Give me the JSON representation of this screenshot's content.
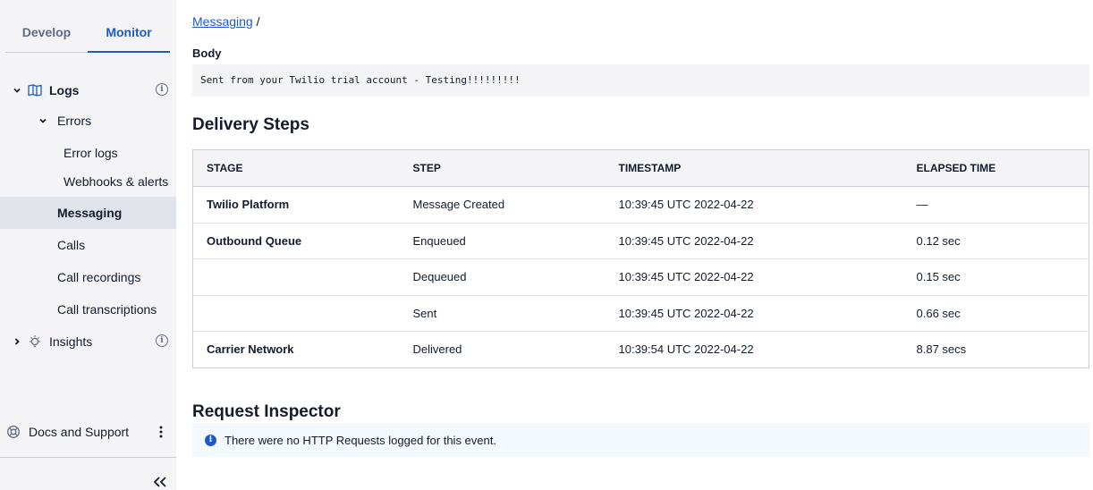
{
  "sidebar": {
    "tabs": [
      {
        "label": "Develop",
        "active": false
      },
      {
        "label": "Monitor",
        "active": true
      }
    ],
    "logs_label": "Logs",
    "errors_label": "Errors",
    "error_logs_label": "Error logs",
    "webhooks_label": "Webhooks & alerts",
    "messaging_label": "Messaging",
    "calls_label": "Calls",
    "call_recordings_label": "Call recordings",
    "call_transcriptions_label": "Call transcriptions",
    "insights_label": "Insights",
    "docs_label": "Docs and Support"
  },
  "main": {
    "breadcrumb": {
      "link": "Messaging",
      "separator": "/"
    },
    "body_label": "Body",
    "body_text": "Sent from your Twilio trial account - Testing!!!!!!!!!",
    "delivery_title": "Delivery Steps",
    "table": {
      "headers": [
        "STAGE",
        "STEP",
        "TIMESTAMP",
        "ELAPSED TIME"
      ],
      "rows": [
        {
          "stage": "Twilio Platform",
          "step": "Message Created",
          "timestamp": "10:39:45 UTC 2022-04-22",
          "elapsed": "—"
        },
        {
          "stage": "Outbound Queue",
          "step": "Enqueued",
          "timestamp": "10:39:45 UTC 2022-04-22",
          "elapsed": "0.12 sec"
        },
        {
          "stage": "",
          "step": "Dequeued",
          "timestamp": "10:39:45 UTC 2022-04-22",
          "elapsed": "0.15 sec"
        },
        {
          "stage": "",
          "step": "Sent",
          "timestamp": "10:39:45 UTC 2022-04-22",
          "elapsed": "0.66 sec"
        },
        {
          "stage": "Carrier Network",
          "step": "Delivered",
          "timestamp": "10:39:54 UTC 2022-04-22",
          "elapsed": "8.87 secs"
        }
      ]
    },
    "inspector_title": "Request Inspector",
    "inspector_notice": "There were no HTTP Requests logged for this event."
  },
  "colors": {
    "accent": "#1f5ac4",
    "sidebar_bg": "#f4f4f6",
    "selected_bg": "#e1e3ea"
  }
}
